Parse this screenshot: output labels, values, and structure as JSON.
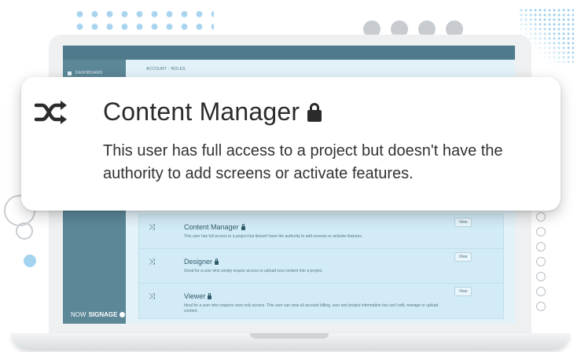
{
  "app": {
    "brand": {
      "prefix": "NOW",
      "suffix": "SIGNAGE"
    }
  },
  "sidebar": {
    "items": [
      {
        "label": "DASHBOARD",
        "icon": "home-icon"
      }
    ]
  },
  "breadcrumb": [
    "ACCOUNT",
    "ROLES"
  ],
  "callout": {
    "icon": "shuffle-icon",
    "title": "Content Manager",
    "lock_icon": "lock-icon",
    "description": "This user has full access to a project but doesn't have the authority to add screens or activate features."
  },
  "roles": [
    {
      "name": "Content Manager",
      "icon": "shuffle-icon",
      "description": "This user has full access to a project but doesn't have the authority to add screens or activate features.",
      "view_label": "View"
    },
    {
      "name": "Designer",
      "icon": "shuffle-icon",
      "description": "Great for a user who simply require access to upload new content into a project.",
      "view_label": "View"
    },
    {
      "name": "Viewer",
      "icon": "shuffle-icon",
      "description": "Ideal for a user who requires view only access. This user can view all account billing, user and project information but can't edit, manage or upload content.",
      "view_label": "View"
    }
  ],
  "colors": {
    "sidebar": "#5b8797",
    "topbar": "#4f7a8b",
    "content_bg": "#cde9f5",
    "accent_dots": "#a8d4ef"
  }
}
